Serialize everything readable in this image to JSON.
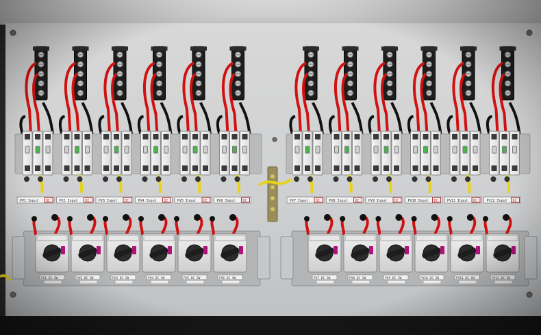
{
  "scene": {
    "description_free": true,
    "left_group": {
      "string_labels": [
        "PV1 Input",
        "PV2 Input",
        "PV3 Input",
        "PV4 Input",
        "PV5 Input",
        "PV6 Input"
      ],
      "dc_tag": "DC",
      "switch_labels": [
        "PV1 DC SW",
        "PV2 DC SW",
        "PV3 DC SW",
        "PV4 DC SW",
        "PV5 DC SW",
        "PV6 DC SW"
      ]
    },
    "right_group": {
      "string_labels": [
        "PV7 Input",
        "PV8 Input",
        "PV9 Input",
        "PV10 Input",
        "PV11 Input",
        "PV12 Input"
      ],
      "dc_tag": "DC",
      "switch_labels": [
        "PV7 DC SW",
        "PV8 DC SW",
        "PV9 DC SW",
        "PV10 DC SW",
        "PV11 DC SW",
        "PV12 DC SW"
      ]
    },
    "colors": {
      "enclosure": "#d8d8d8",
      "backplate": "#cfd1d3",
      "wire_red": "#d11111",
      "wire_black": "#111111",
      "wire_yellow": "#e7d21a",
      "switch_knob": "#1d1d1d",
      "switch_accent": "#b0127a"
    }
  }
}
